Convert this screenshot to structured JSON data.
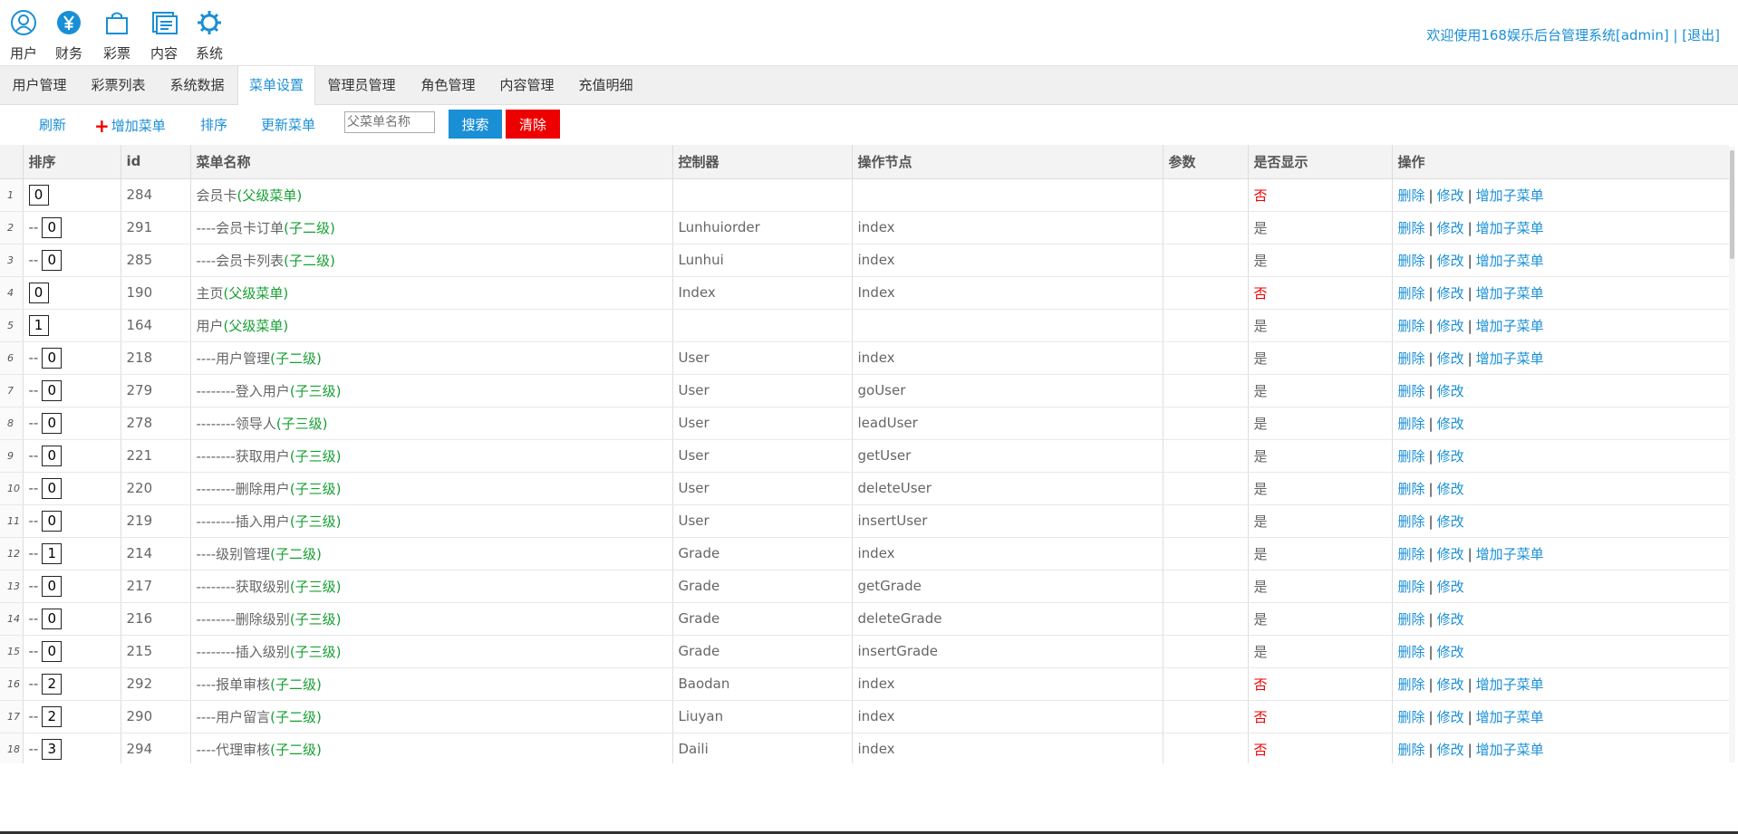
{
  "topnav": {
    "items": [
      {
        "label": "用户",
        "icon": "user-icon"
      },
      {
        "label": "财务",
        "icon": "yen-icon"
      },
      {
        "label": "彩票",
        "icon": "bag-icon"
      },
      {
        "label": "内容",
        "icon": "document-icon"
      },
      {
        "label": "系统",
        "icon": "gear-icon"
      }
    ],
    "welcome_text": "欢迎使用168娱乐后台管理系统[admin] | ",
    "logout_label": "[退出]"
  },
  "tabs": [
    {
      "label": "用户管理",
      "active": false
    },
    {
      "label": "彩票列表",
      "active": false
    },
    {
      "label": "系统数据",
      "active": false
    },
    {
      "label": "菜单设置",
      "active": true
    },
    {
      "label": "管理员管理",
      "active": false
    },
    {
      "label": "角色管理",
      "active": false
    },
    {
      "label": "内容管理",
      "active": false
    },
    {
      "label": "充值明细",
      "active": false
    }
  ],
  "toolbar": {
    "refresh": "刷新",
    "add_menu": "增加菜单",
    "sort": "排序",
    "update_menu": "更新菜单",
    "search_placeholder": "父菜单名称",
    "search_button": "搜索",
    "clear_button": "清除"
  },
  "table": {
    "headers": {
      "sort": "排序",
      "id": "id",
      "name": "菜单名称",
      "controller": "控制器",
      "action": "操作节点",
      "params": "参数",
      "visible": "是否显示",
      "ops": "操作"
    },
    "ops_labels": {
      "delete": "删除",
      "edit": "修改",
      "add_child": "增加子菜单"
    },
    "rows": [
      {
        "rn": "1",
        "prefix": "",
        "sort": "0",
        "id": "284",
        "name": "会员卡",
        "level": "(父级菜单)",
        "controller": "",
        "action": "",
        "params": "",
        "visible": "否",
        "add_child": true
      },
      {
        "rn": "2",
        "prefix": "--",
        "sort": "0",
        "id": "291",
        "name": "----会员卡订单",
        "level": "(子二级)",
        "controller": "Lunhuiorder",
        "action": "index",
        "params": "",
        "visible": "是",
        "add_child": true
      },
      {
        "rn": "3",
        "prefix": "--",
        "sort": "0",
        "id": "285",
        "name": "----会员卡列表",
        "level": "(子二级)",
        "controller": "Lunhui",
        "action": "index",
        "params": "",
        "visible": "是",
        "add_child": true
      },
      {
        "rn": "4",
        "prefix": "",
        "sort": "0",
        "id": "190",
        "name": "主页",
        "level": "(父级菜单)",
        "controller": "Index",
        "action": "Index",
        "params": "",
        "visible": "否",
        "add_child": true
      },
      {
        "rn": "5",
        "prefix": "",
        "sort": "1",
        "id": "164",
        "name": "用户",
        "level": "(父级菜单)",
        "controller": "",
        "action": "",
        "params": "",
        "visible": "是",
        "add_child": true
      },
      {
        "rn": "6",
        "prefix": "--",
        "sort": "0",
        "id": "218",
        "name": "----用户管理",
        "level": "(子二级)",
        "controller": "User",
        "action": "index",
        "params": "",
        "visible": "是",
        "add_child": true
      },
      {
        "rn": "7",
        "prefix": "--",
        "sort": "0",
        "id": "279",
        "name": "--------登入用户",
        "level": "(子三级)",
        "controller": "User",
        "action": "goUser",
        "params": "",
        "visible": "是",
        "add_child": false
      },
      {
        "rn": "8",
        "prefix": "--",
        "sort": "0",
        "id": "278",
        "name": "--------领导人",
        "level": "(子三级)",
        "controller": "User",
        "action": "leadUser",
        "params": "",
        "visible": "是",
        "add_child": false
      },
      {
        "rn": "9",
        "prefix": "--",
        "sort": "0",
        "id": "221",
        "name": "--------获取用户",
        "level": "(子三级)",
        "controller": "User",
        "action": "getUser",
        "params": "",
        "visible": "是",
        "add_child": false
      },
      {
        "rn": "10",
        "prefix": "--",
        "sort": "0",
        "id": "220",
        "name": "--------删除用户",
        "level": "(子三级)",
        "controller": "User",
        "action": "deleteUser",
        "params": "",
        "visible": "是",
        "add_child": false
      },
      {
        "rn": "11",
        "prefix": "--",
        "sort": "0",
        "id": "219",
        "name": "--------插入用户",
        "level": "(子三级)",
        "controller": "User",
        "action": "insertUser",
        "params": "",
        "visible": "是",
        "add_child": false
      },
      {
        "rn": "12",
        "prefix": "--",
        "sort": "1",
        "id": "214",
        "name": "----级别管理",
        "level": "(子二级)",
        "controller": "Grade",
        "action": "index",
        "params": "",
        "visible": "是",
        "add_child": true
      },
      {
        "rn": "13",
        "prefix": "--",
        "sort": "0",
        "id": "217",
        "name": "--------获取级别",
        "level": "(子三级)",
        "controller": "Grade",
        "action": "getGrade",
        "params": "",
        "visible": "是",
        "add_child": false
      },
      {
        "rn": "14",
        "prefix": "--",
        "sort": "0",
        "id": "216",
        "name": "--------删除级别",
        "level": "(子三级)",
        "controller": "Grade",
        "action": "deleteGrade",
        "params": "",
        "visible": "是",
        "add_child": false
      },
      {
        "rn": "15",
        "prefix": "--",
        "sort": "0",
        "id": "215",
        "name": "--------插入级别",
        "level": "(子三级)",
        "controller": "Grade",
        "action": "insertGrade",
        "params": "",
        "visible": "是",
        "add_child": false
      },
      {
        "rn": "16",
        "prefix": "--",
        "sort": "2",
        "id": "292",
        "name": "----报单审核",
        "level": "(子二级)",
        "controller": "Baodan",
        "action": "index",
        "params": "",
        "visible": "否",
        "add_child": true
      },
      {
        "rn": "17",
        "prefix": "--",
        "sort": "2",
        "id": "290",
        "name": "----用户留言",
        "level": "(子二级)",
        "controller": "Liuyan",
        "action": "index",
        "params": "",
        "visible": "否",
        "add_child": true
      },
      {
        "rn": "18",
        "prefix": "--",
        "sort": "3",
        "id": "294",
        "name": "----代理审核",
        "level": "(子二级)",
        "controller": "Daili",
        "action": "index",
        "params": "",
        "visible": "否",
        "add_child": true
      }
    ]
  },
  "colors": {
    "accent": "#1a8fd6",
    "danger": "#ee0000",
    "level_green": "#16a032"
  }
}
